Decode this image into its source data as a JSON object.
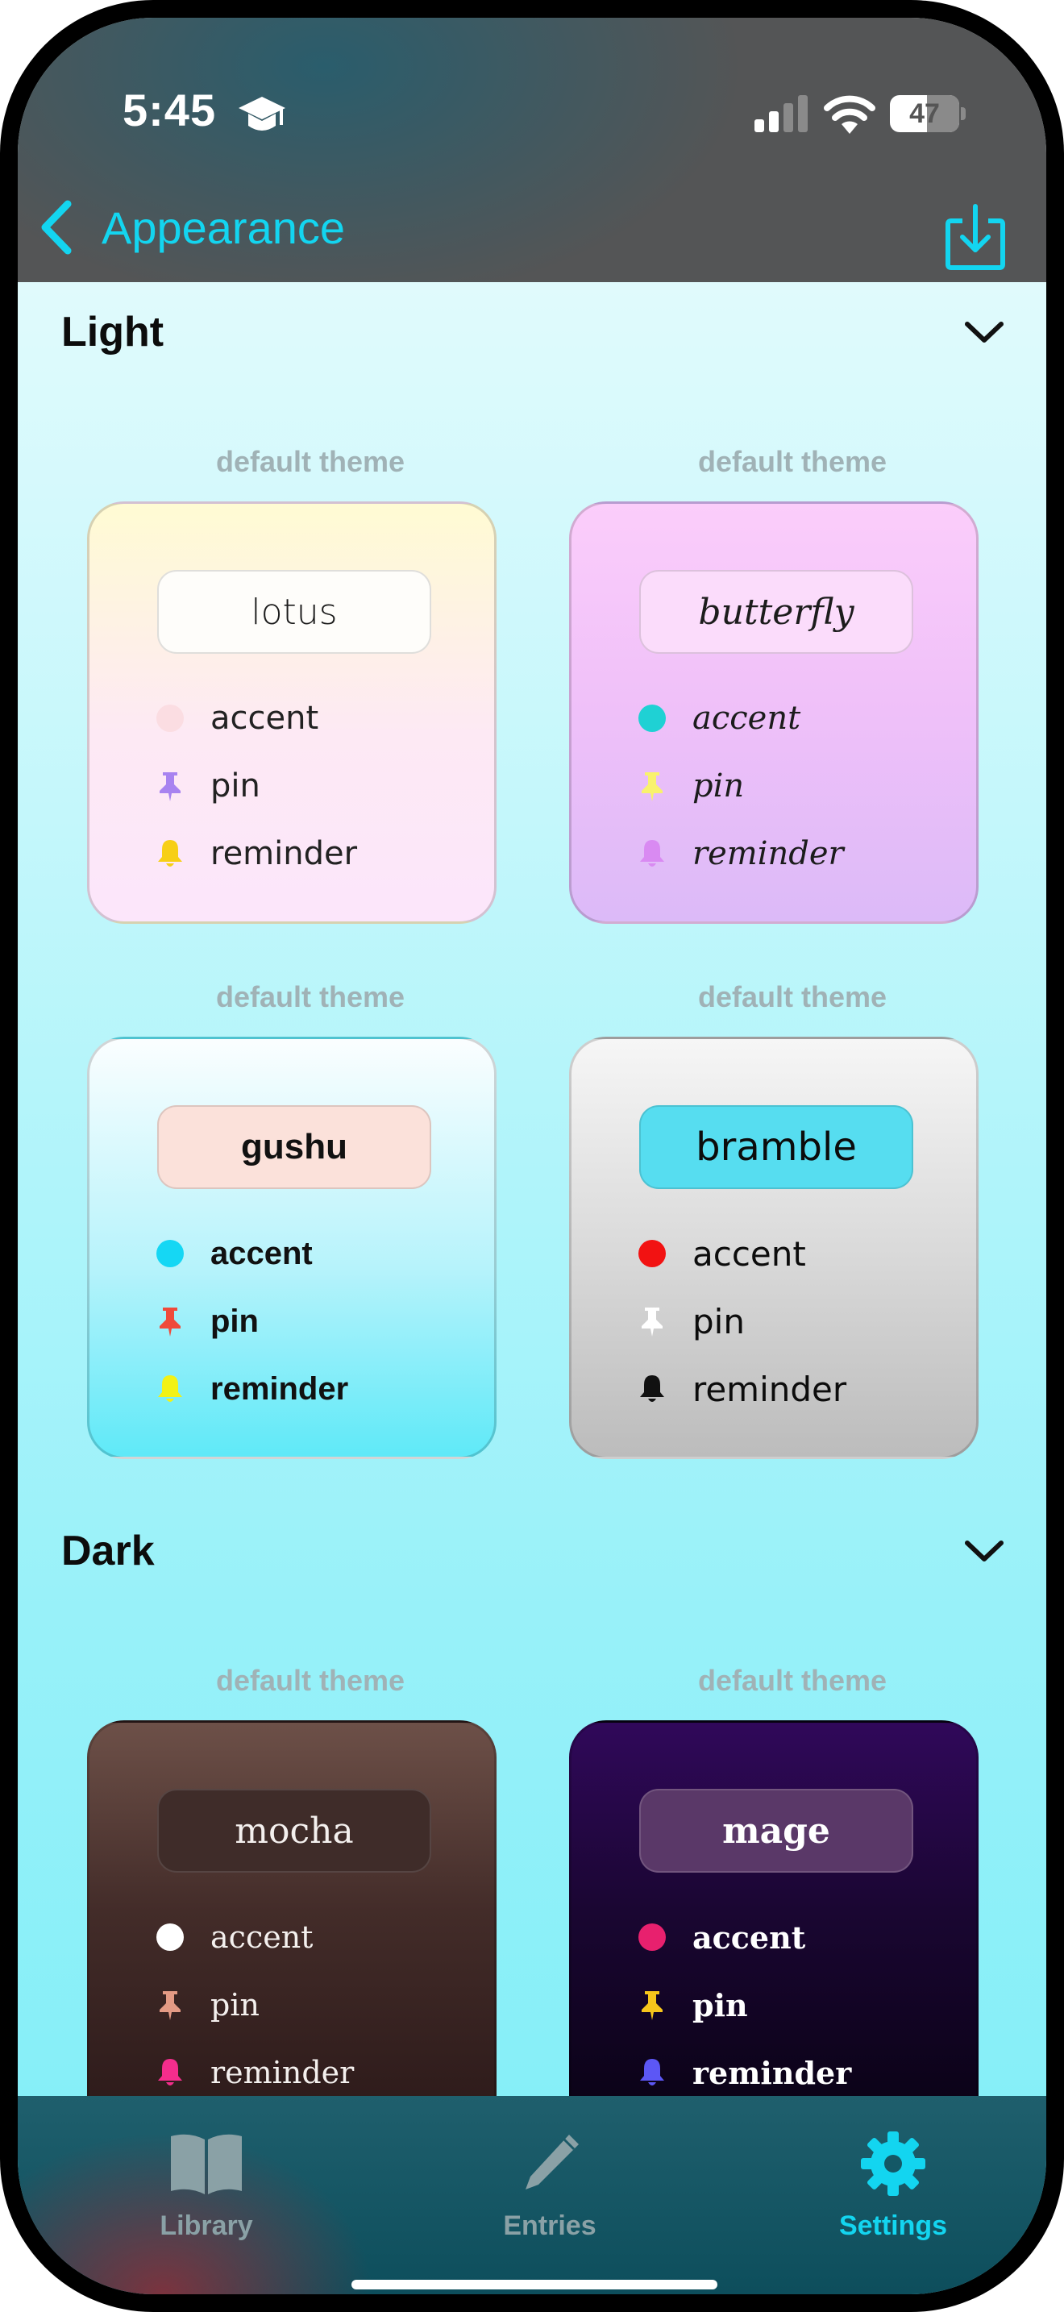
{
  "status_bar": {
    "time": "5:45",
    "battery_level": "47"
  },
  "header": {
    "title": "Appearance"
  },
  "sections": {
    "light": {
      "title": "Light",
      "cards": [
        {
          "caption": "default theme",
          "name": "lotus",
          "accent_label": "accent",
          "pin_label": "pin",
          "reminder_label": "reminder",
          "colors": {
            "accent": "#fbdde2",
            "pin": "#a883f0",
            "reminder": "#f7cf16"
          }
        },
        {
          "caption": "default theme",
          "name": "butterfly",
          "accent_label": "accent",
          "pin_label": "pin",
          "reminder_label": "reminder",
          "colors": {
            "accent": "#1fd1d4",
            "pin": "#f9f26d",
            "reminder": "#d98af2"
          }
        },
        {
          "caption": "default theme",
          "name": "gushu",
          "accent_label": "accent",
          "pin_label": "pin",
          "reminder_label": "reminder",
          "colors": {
            "accent": "#15d7f4",
            "pin": "#f04a3a",
            "reminder": "#f2f215"
          }
        },
        {
          "caption": "default theme",
          "name": "bramble",
          "accent_label": "accent",
          "pin_label": "pin",
          "reminder_label": "reminder",
          "colors": {
            "accent": "#f21212",
            "pin": "#ffffff",
            "reminder": "#111111"
          }
        }
      ]
    },
    "dark": {
      "title": "Dark",
      "cards": [
        {
          "caption": "default theme",
          "name": "mocha",
          "accent_label": "accent",
          "pin_label": "pin",
          "reminder_label": "reminder",
          "colors": {
            "accent": "#ffffff",
            "pin": "#e39a84",
            "reminder": "#f42d8c"
          }
        },
        {
          "caption": "default theme",
          "name": "mage",
          "accent_label": "accent",
          "pin_label": "pin",
          "reminder_label": "reminder",
          "colors": {
            "accent": "#e8206e",
            "pin": "#f6c51b",
            "reminder": "#5c57f5"
          }
        }
      ]
    }
  },
  "tabs": [
    {
      "label": "Library",
      "icon": "book-icon",
      "active": false
    },
    {
      "label": "Entries",
      "icon": "pencil-icon",
      "active": false
    },
    {
      "label": "Settings",
      "icon": "gear-icon",
      "active": true
    }
  ],
  "colors": {
    "accent": "#13d5f0",
    "inactive_tab": "#8aa1a6"
  }
}
